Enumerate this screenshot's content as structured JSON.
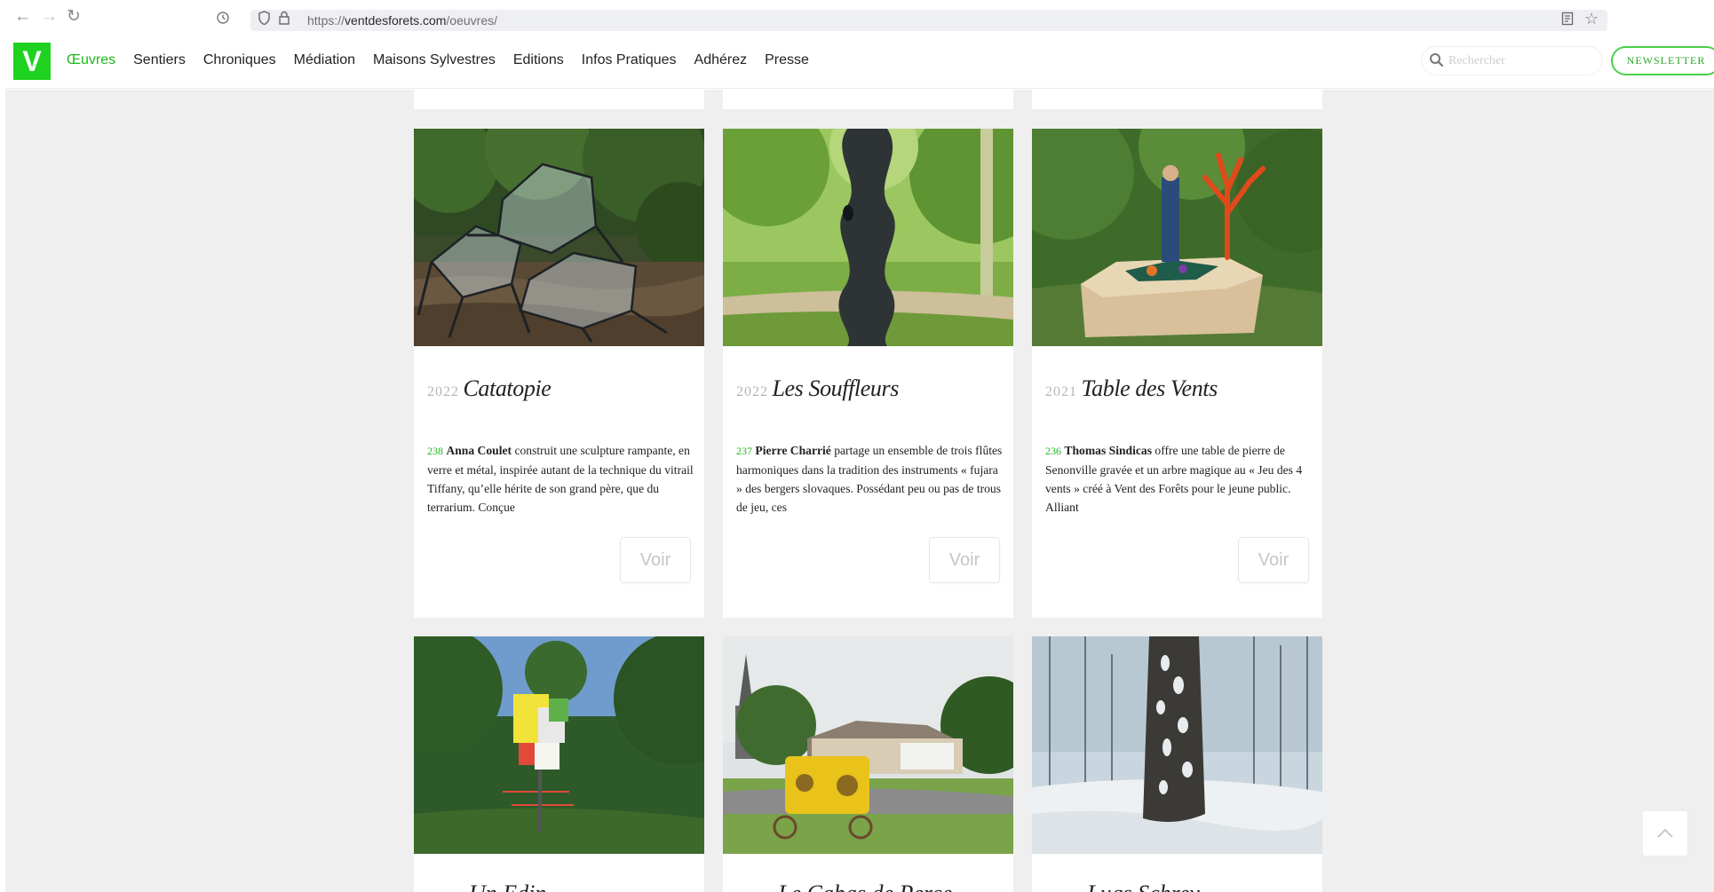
{
  "browser": {
    "url_scheme": "https://",
    "url_host": "ventdesforets.com",
    "url_path": "/oeuvres/"
  },
  "header": {
    "logo": "V",
    "nav": [
      "Œuvres",
      "Sentiers",
      "Chroniques",
      "Médiation",
      "Maisons Sylvestres",
      "Editions",
      "Infos Pratiques",
      "Adhérez",
      "Presse"
    ],
    "active_nav": "Œuvres",
    "search_placeholder": "Rechercher",
    "newsletter_label": "NEWSLETTER"
  },
  "cards": [
    {
      "year": "2022",
      "title": "Catatopie",
      "number": "238",
      "artist": "Anna Coulet",
      "description": " construit une sculpture rampante, en verre et métal, inspirée autant de la technique du vitrail Tiffany, qu’elle hérite de son grand père, que du terrarium. Conçue",
      "button": "Voir"
    },
    {
      "year": "2022",
      "title": "Les Souffleurs",
      "number": "237",
      "artist": "Pierre Charrié",
      "description": " partage un ensemble de trois flûtes harmoniques dans la tradition des instruments « fujara » des bergers slovaques. Possédant peu ou pas de trous de jeu, ces",
      "button": "Voir"
    },
    {
      "year": "2021",
      "title": "Table des Vents",
      "number": "236",
      "artist": "Thomas Sindicas",
      "description": " offre une table de pierre de Senonville gravée et un arbre magique au « Jeu des 4 vents » créé à Vent des Forêts pour le jeune public. Alliant",
      "button": "Voir"
    }
  ],
  "partial_cards": [
    {
      "title": "Un Edin"
    },
    {
      "title": "Le Cabas de Perce"
    },
    {
      "title": "Lugs Schrey"
    }
  ],
  "colors": {
    "brand_green": "#1fd21f",
    "link_green": "#1fb81f",
    "page_bg": "#efefef"
  }
}
